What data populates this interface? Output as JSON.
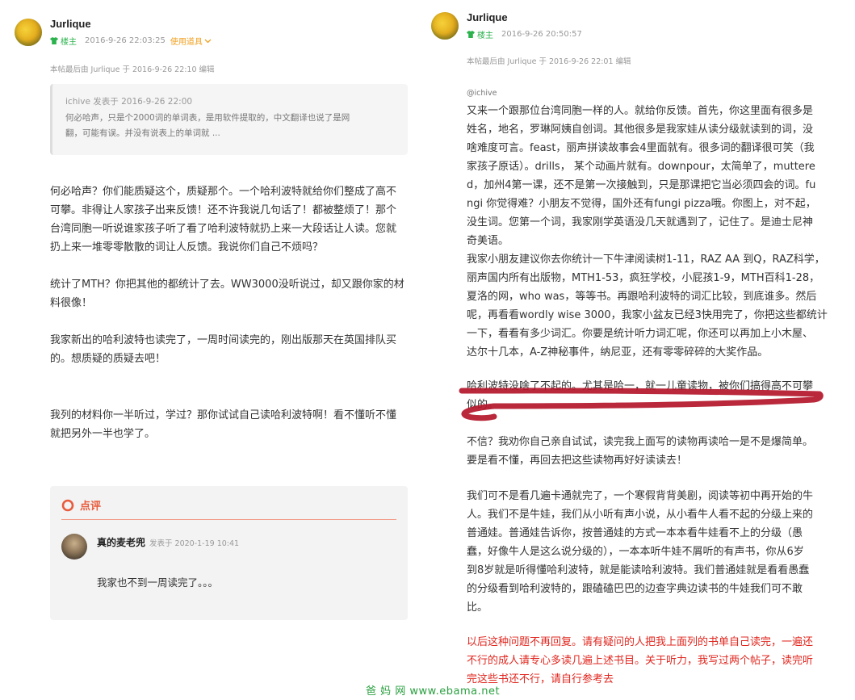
{
  "left": {
    "author": "Jurlique",
    "owner_tag": "楼主",
    "time": "2016-9-26 22:03:25",
    "tool_link": "使用道具",
    "edit_note": "本帖最后由 Jurlique 于 2016-9-26 22:10 编辑",
    "quote": {
      "head": "ichive 发表于 2016-9-26 22:00",
      "lines": [
        "何必哈声，只是个2000词的单词表，是用软件提取的，中文翻译也说了是网",
        "翻，可能有误。并没有说表上的单词就 ..."
      ]
    },
    "paragraphs": [
      [
        "何必哈声？你们能质疑这个，质疑那个。一个哈利波特就给你们整成了高不",
        "可攀。非得让人家孩子出来反馈！还不许我说几句话了！都被整烦了！那个",
        "台湾同胞一听说谁家孩子听了看了哈利波特就扔上来一大段话让人读。您就",
        "扔上来一堆零零散散的词让人反馈。我说你们自己不烦吗？"
      ],
      [
        "统计了MTH？你把其他的都统计了去。WW3000没听说过，却又跟你家的材",
        "料很像！"
      ],
      [
        "我家新出的哈利波特也读完了，一周时间读完的，刚出版那天在英国排队买",
        "的。想质疑的质疑去吧！"
      ],
      [
        "我列的材料你一半听过，学过？那你试试自己读哈利波特啊！看不懂听不懂",
        "就把另外一半也学了。"
      ]
    ],
    "comment": {
      "title": "点评",
      "author": "真的麦老兜",
      "time": "发表于 2020-1-19 10:41",
      "text": "我家也不到一周读完了。。。"
    }
  },
  "right": {
    "author": "Jurlique",
    "owner_tag": "楼主",
    "time": "2016-9-26 20:50:57",
    "edit_note": "本帖最后由 Jurlique 于 2016-9-26 22:01 编辑",
    "mention": "@ichive",
    "paragraphs": [
      [
        "又来一个跟那位台湾同胞一样的人。就给你反馈。首先，你这里面有很多是",
        "姓名，地名，罗琳阿姨自创词。其他很多是我家娃从读分级就读到的词，没",
        "啥难度可言。feast，丽声拼读故事会4里面就有。很多词的翻译很可笑（我",
        "家孩子原话）。drills， 某个动画片就有。downpour，太简单了，muttere",
        "d，加州4第一课，还不是第一次接触到，只是那课把它当必须四会的词。fu",
        "ngi 你觉得难？小朋友不觉得，国外还有fungi pizza哦。你图上，对不起，",
        "没生词。您第一个词，我家刚学英语没几天就遇到了，记住了。是迪士尼神",
        "奇美语。",
        "我家小朋友建议你去你统计一下牛津阅读树1-11，RAZ AA 到Q，RAZ科学，",
        "丽声国内所有出版物，MTH1-53，疯狂学校，小屁孩1-9，MTH百科1-28，",
        "夏洛的网，who was，等等书。再跟哈利波特的词汇比较，到底谁多。然后",
        "呢，再看看wordly wise 3000，我家小盆友已经3快用完了，你把这些都统计",
        "一下，看看有多少词汇。你要是统计听力词汇呢，你还可以再加上小木屋、",
        "达尔十几本，A-Z神秘事件，纳尼亚，还有零零碎碎的大奖作品。"
      ],
      [
        "哈利波特没啥了不起的。尤其是哈一，就一儿童读物，被你们搞得高不可攀",
        "似的。"
      ],
      [
        "不信？我劝你自己亲自试试，读完我上面写的读物再读哈一是不是爆简单。",
        "要是看不懂，再回去把这些读物再好好读读去！"
      ],
      [
        "我们可不是看几遍卡通就完了，一个寒假背背美剧，阅读等初中再开始的牛",
        "人。我们不是牛娃，我们从小听有声小说，从小看牛人看不起的分级上来的",
        "普通娃。普通娃告诉你，按普通娃的方式一本本看牛娃看不上的分级（愚",
        "蠢，好像牛人是这么说分级的），一本本听牛娃不屑听的有声书，你从6岁",
        "到8岁就是听得懂哈利波特，就是能读哈利波特。我们普通娃就是看看愚蠢",
        "的分级看到哈利波特的，跟磕磕巴巴的边查字典边读书的牛娃我们可不敢",
        "比。"
      ],
      [
        "以后这种问题不再回复。请有疑问的人把我上面列的书单自己读完，一遍还",
        "不行的成人请专心多读几遍上述书目。关于听力，我写过两个帖子，读完听",
        "完这些书还不行，请自行参考去"
      ]
    ]
  },
  "watermark": "爸 妈 网  www.ebama.net",
  "colors": {
    "owner_green": "#2bb24c",
    "tool_orange": "#f0a020",
    "comment_red": "#e85a3b",
    "alert_red": "#e0271f",
    "scribble": "#b3162a",
    "watermark_green": "#2aa040"
  }
}
